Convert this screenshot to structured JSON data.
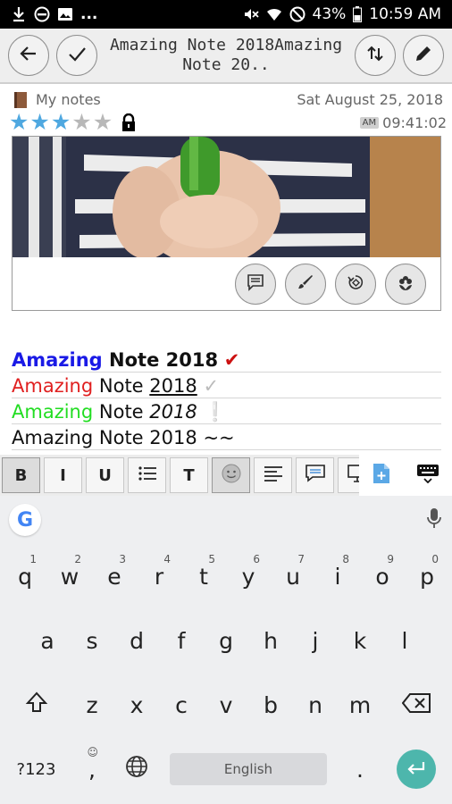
{
  "status_bar": {
    "left_icons": [
      "download-icon",
      "do-not-disturb-icon",
      "image-icon"
    ],
    "more": "...",
    "right_icons": [
      "mute-icon",
      "wifi-icon",
      "no-signal-icon"
    ],
    "battery": "43%",
    "time": "10:59 AM"
  },
  "toolbar": {
    "title": "Amazing Note 2018Amazing\nNote 20..",
    "buttons": [
      "back-icon",
      "check-icon",
      "sort-icon",
      "pencil-icon"
    ]
  },
  "note_info": {
    "notebook": "My notes",
    "date": "Sat August 25, 2018",
    "rating": 3,
    "rating_max": 5,
    "ampm": "AM",
    "time": "09:41:02"
  },
  "image_card": {
    "actions": [
      "comment-icon",
      "brush-icon",
      "rotate-icon",
      "flower-icon"
    ]
  },
  "note_lines": [
    {
      "word1": "Amazing",
      "word2": "Note",
      "word3": "2018",
      "mark": "✔",
      "word1_color": "#1a1ae6",
      "mark_color": "#cc1111"
    },
    {
      "word1": "Amazing",
      "word2": "Note",
      "word3": "2018",
      "mark": "✓",
      "word1_color": "#e02020",
      "mark_color": "#bbbbbb"
    },
    {
      "word1": "Amazing",
      "word2": "Note",
      "word3": "2018",
      "mark": "❕",
      "word1_color": "#22dd22",
      "mark_color": "#333333"
    },
    {
      "word1": "Amazing",
      "word2": "Note",
      "word3": "2018",
      "mark": "~~",
      "word1_color": "#111111",
      "mark_color": "#111111"
    }
  ],
  "format_bar": {
    "bold": "B",
    "italic": "I",
    "underline": "U",
    "text": "T",
    "icons": [
      "list-icon",
      "emoji-icon",
      "align-icon",
      "comment-icon",
      "screen-icon",
      "add-file-icon",
      "keyboard-icon"
    ]
  },
  "keyboard": {
    "row1": [
      [
        "q",
        "1"
      ],
      [
        "w",
        "2"
      ],
      [
        "e",
        "3"
      ],
      [
        "r",
        "4"
      ],
      [
        "t",
        "5"
      ],
      [
        "y",
        "6"
      ],
      [
        "u",
        "7"
      ],
      [
        "i",
        "8"
      ],
      [
        "o",
        "9"
      ],
      [
        "p",
        "0"
      ]
    ],
    "row2": [
      "a",
      "s",
      "d",
      "f",
      "g",
      "h",
      "j",
      "k",
      "l"
    ],
    "row3": [
      "z",
      "x",
      "c",
      "v",
      "b",
      "n",
      "m"
    ],
    "symbols_key": "?123",
    "comma": ",",
    "period": ".",
    "space_label": "English",
    "google_letter": "G"
  },
  "colors": {
    "accent": "#4db6ac",
    "star_filled": "#4fa8e0",
    "star_empty": "#b8b8b8"
  }
}
